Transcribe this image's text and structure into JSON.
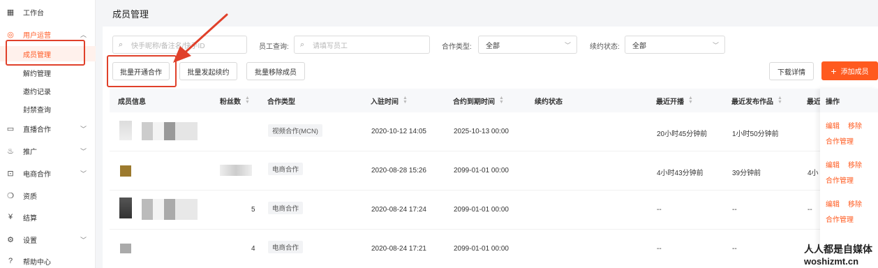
{
  "sidebar": {
    "items": [
      {
        "label": "工作台",
        "icon": "dashboard-icon",
        "glyph": "▦"
      },
      {
        "label": "用户运营",
        "icon": "user-ops-icon",
        "glyph": "◎",
        "expanded": true
      },
      {
        "label": "成员管理",
        "active": true
      },
      {
        "label": "解约管理"
      },
      {
        "label": "邀约记录"
      },
      {
        "label": "封禁查询"
      },
      {
        "label": "直播合作",
        "icon": "live-icon",
        "glyph": "▭"
      },
      {
        "label": "推广",
        "icon": "flame-icon",
        "glyph": "♨"
      },
      {
        "label": "电商合作",
        "icon": "bag-icon",
        "glyph": "⊡"
      },
      {
        "label": "资质",
        "icon": "badge-icon",
        "glyph": "❍"
      },
      {
        "label": "结算",
        "icon": "yen-icon",
        "glyph": "¥"
      },
      {
        "label": "设置",
        "icon": "gear-icon",
        "glyph": "⚙"
      },
      {
        "label": "帮助中心",
        "icon": "help-icon",
        "glyph": "?"
      }
    ]
  },
  "page": {
    "title": "成员管理"
  },
  "filters": {
    "search_placeholder": "快手昵称/备注名/快手ID",
    "staff_label": "员工查询:",
    "staff_placeholder": "请填写员工",
    "coop_type_label": "合作类型:",
    "coop_type_value": "全部",
    "renewal_label": "续约状态:",
    "renewal_value": "全部"
  },
  "actions": {
    "batch_open": "批量开通合作",
    "batch_renew": "批量发起续约",
    "batch_remove": "批量移除成员",
    "download": "下载详情",
    "add_member": "添加成员"
  },
  "table": {
    "headers": {
      "member": "成员信息",
      "fans": "粉丝数",
      "coop_type": "合作类型",
      "join_time": "入驻时间",
      "expire_time": "合约到期时间",
      "renewal": "续约状态",
      "last_live": "最近开播",
      "last_work": "最近发布作品",
      "next": "最近",
      "ops": "操作"
    },
    "rows": [
      {
        "fans": "",
        "coop_type": "视频合作(MCN)",
        "join_time": "2020-10-12 14:05",
        "expire_time": "2025-10-13 00:00",
        "last_live": "20小时45分钟前",
        "last_work": "1小时50分钟前",
        "next": ""
      },
      {
        "fans": "",
        "coop_type": "电商合作",
        "join_time": "2020-08-28 15:26",
        "expire_time": "2099-01-01 00:00",
        "last_live": "4小时43分钟前",
        "last_work": "39分钟前",
        "next": "4小"
      },
      {
        "fans": "5",
        "coop_type": "电商合作",
        "join_time": "2020-08-24 17:24",
        "expire_time": "2099-01-01 00:00",
        "last_live": "--",
        "last_work": "--",
        "next": "--"
      },
      {
        "fans": "4",
        "coop_type": "电商合作",
        "join_time": "2020-08-24 17:21",
        "expire_time": "2099-01-01 00:00",
        "last_live": "--",
        "last_work": "--",
        "next": "--"
      }
    ],
    "ops": {
      "edit": "编辑",
      "remove": "移除",
      "manage": "合作管理"
    }
  },
  "watermark": {
    "line1": "人人都是自媒体",
    "line2": "woshizmt.cn"
  },
  "colors": {
    "accent": "#ff5a1f",
    "annotation_red": "#e0402a"
  }
}
